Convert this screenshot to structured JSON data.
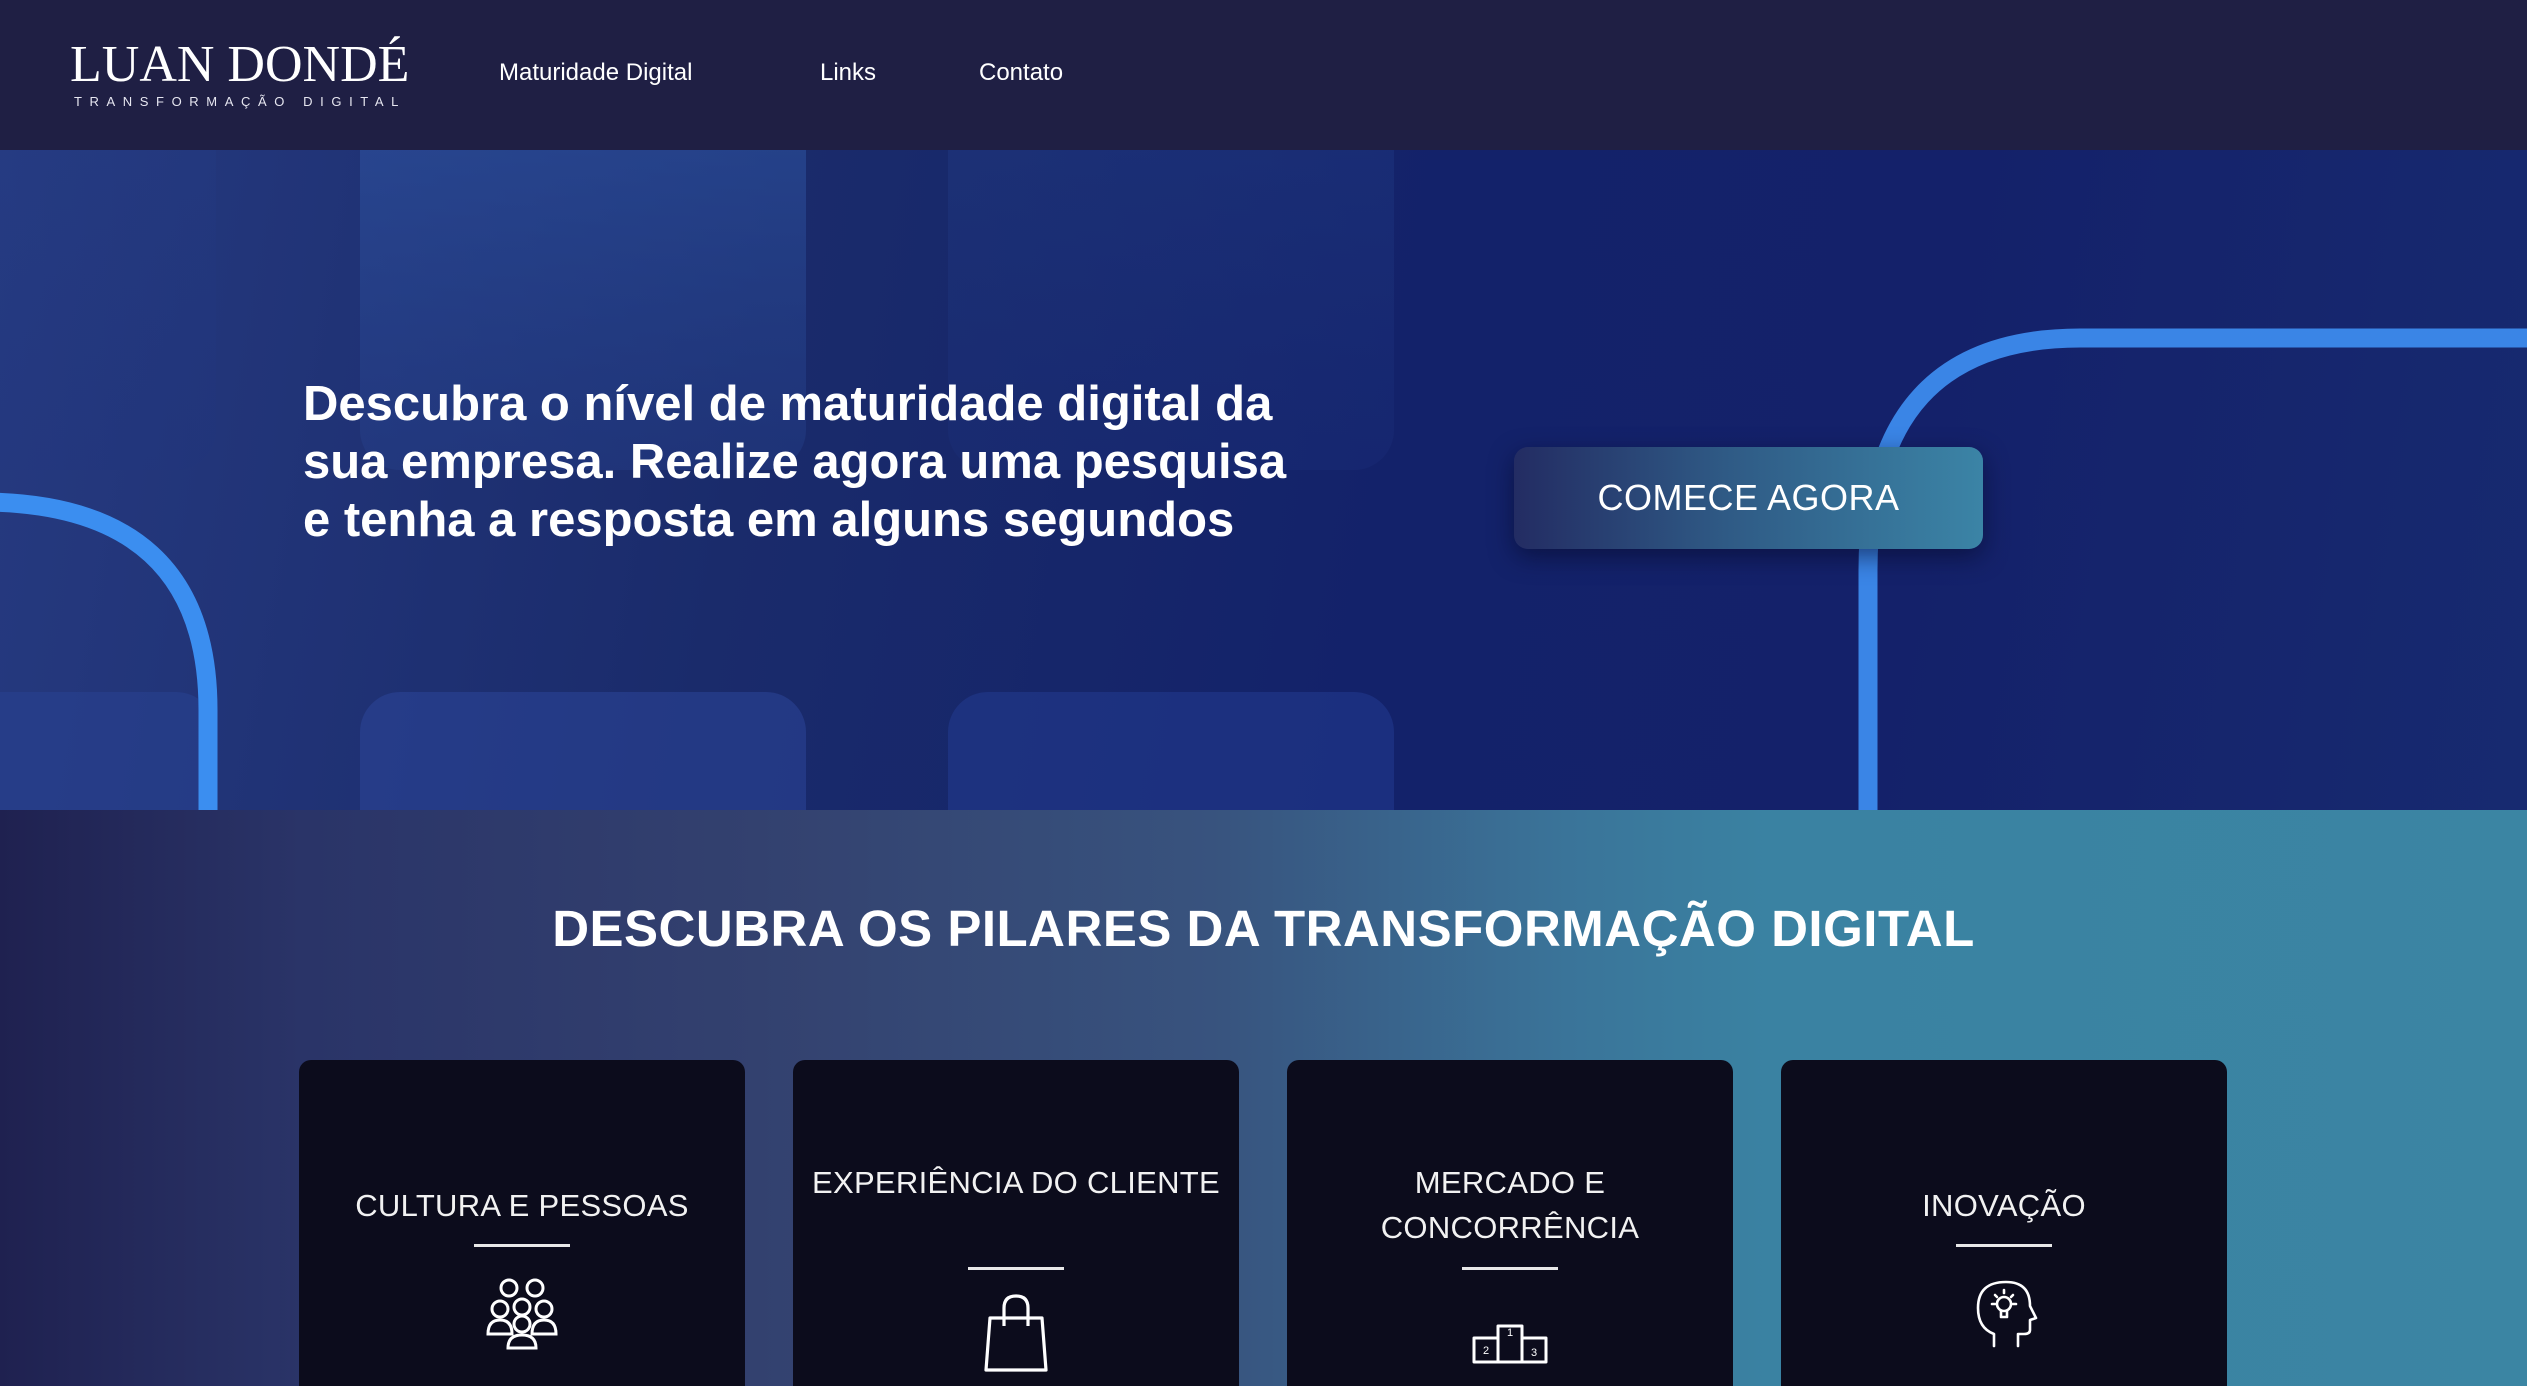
{
  "header": {
    "logo": {
      "name": "LUAN DONDÉ",
      "tagline": "TRANSFORMAÇÃO DIGITAL"
    },
    "nav": [
      {
        "label": "Maturidade Digital"
      },
      {
        "label": "Links"
      },
      {
        "label": "Contato"
      }
    ]
  },
  "hero": {
    "headline": "Descubra o nível de maturidade digital da sua empresa. Realize agora uma pesquisa e tenha a resposta em alguns segundos",
    "cta_label": "COMECE AGORA"
  },
  "pillars": {
    "title": "DESCUBRA OS PILARES DA TRANSFORMAÇÃO DIGITAL",
    "cards": [
      {
        "title": "CULTURA E PESSOAS",
        "icon": "people-group-icon"
      },
      {
        "title": "EXPERIÊNCIA DO CLIENTE",
        "icon": "shopping-bag-icon"
      },
      {
        "title": "MERCADO E CONCORRÊNCIA",
        "icon": "podium-icon"
      },
      {
        "title": "INOVAÇÃO",
        "icon": "head-lightbulb-icon"
      }
    ]
  },
  "colors": {
    "header_bg": "#1f1f44",
    "hero_bg": "#14216a",
    "accent_blue": "#3b8ef0",
    "cta_gradient_end": "#3b84a6",
    "card_bg": "#0c0c1c"
  }
}
